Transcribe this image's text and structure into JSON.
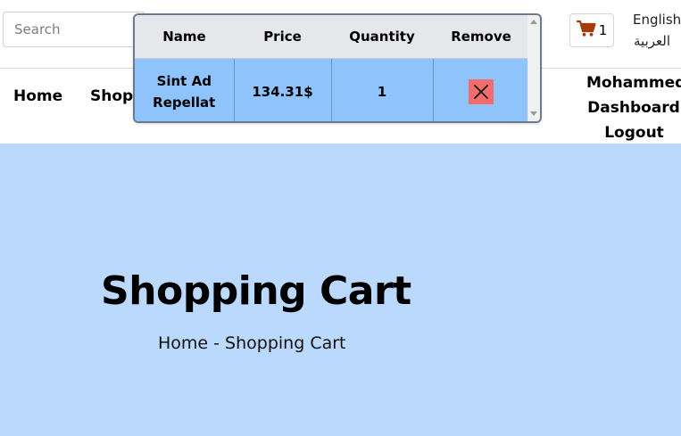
{
  "header": {
    "search_placeholder": "Search",
    "cart_icon": "shopping-cart-icon",
    "cart_count": "1",
    "languages": [
      "English",
      "العربية"
    ]
  },
  "nav": {
    "links": [
      "Home",
      "Shop"
    ],
    "user": {
      "name": "Mohammed",
      "dashboard": "Dashboard",
      "logout": "Logout"
    }
  },
  "hero": {
    "title": "Shopping Cart",
    "breadcrumb": {
      "home": "Home",
      "separator": " - ",
      "current": "Shopping Cart"
    }
  },
  "cart_popup": {
    "headers": [
      "Name",
      "Price",
      "Quantity",
      "Remove"
    ],
    "rows": [
      {
        "name_line1": "Sint Ad",
        "name_line2": "Repellat",
        "price": "134.31$",
        "quantity": "1",
        "remove_icon": "close-icon"
      }
    ]
  },
  "colors": {
    "hero_bg": "#bbd8fd",
    "row_bg": "#8fc3fc",
    "remove_bg": "#f26d6d",
    "cart_icon": "#a53d0a"
  }
}
